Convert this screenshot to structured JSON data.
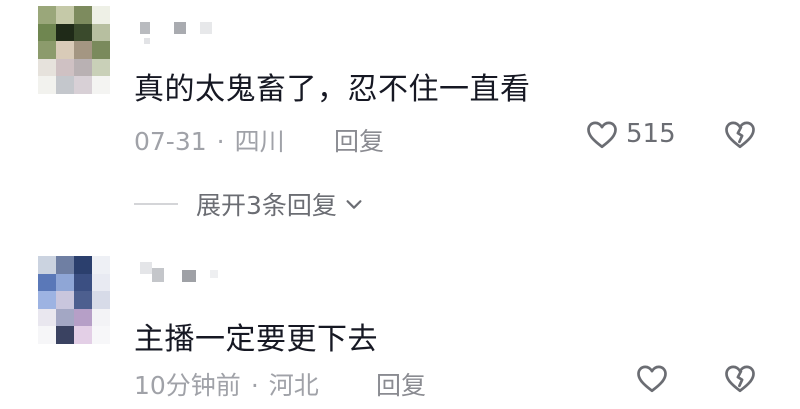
{
  "comments": [
    {
      "text": "真的太鬼畜了，忍不住一直看",
      "date": "07-31",
      "location": "四川",
      "reply_label": "回复",
      "like_count": "515",
      "expand_label": "展开3条回复",
      "avatar_icon": "pixelated-avatar-icon",
      "like_icon": "heart-outline-icon",
      "dislike_icon": "broken-heart-icon"
    },
    {
      "text": "主播一定要更下去",
      "date": "10分钟前",
      "location": "河北",
      "reply_label": "回复",
      "like_count": "",
      "avatar_icon": "pixelated-avatar-icon",
      "like_icon": "heart-outline-icon",
      "dislike_icon": "broken-heart-icon"
    }
  ],
  "separator": "·",
  "colors": {
    "text": "#161823",
    "meta": "#a0a2a8",
    "icon": "#6b6d73"
  }
}
